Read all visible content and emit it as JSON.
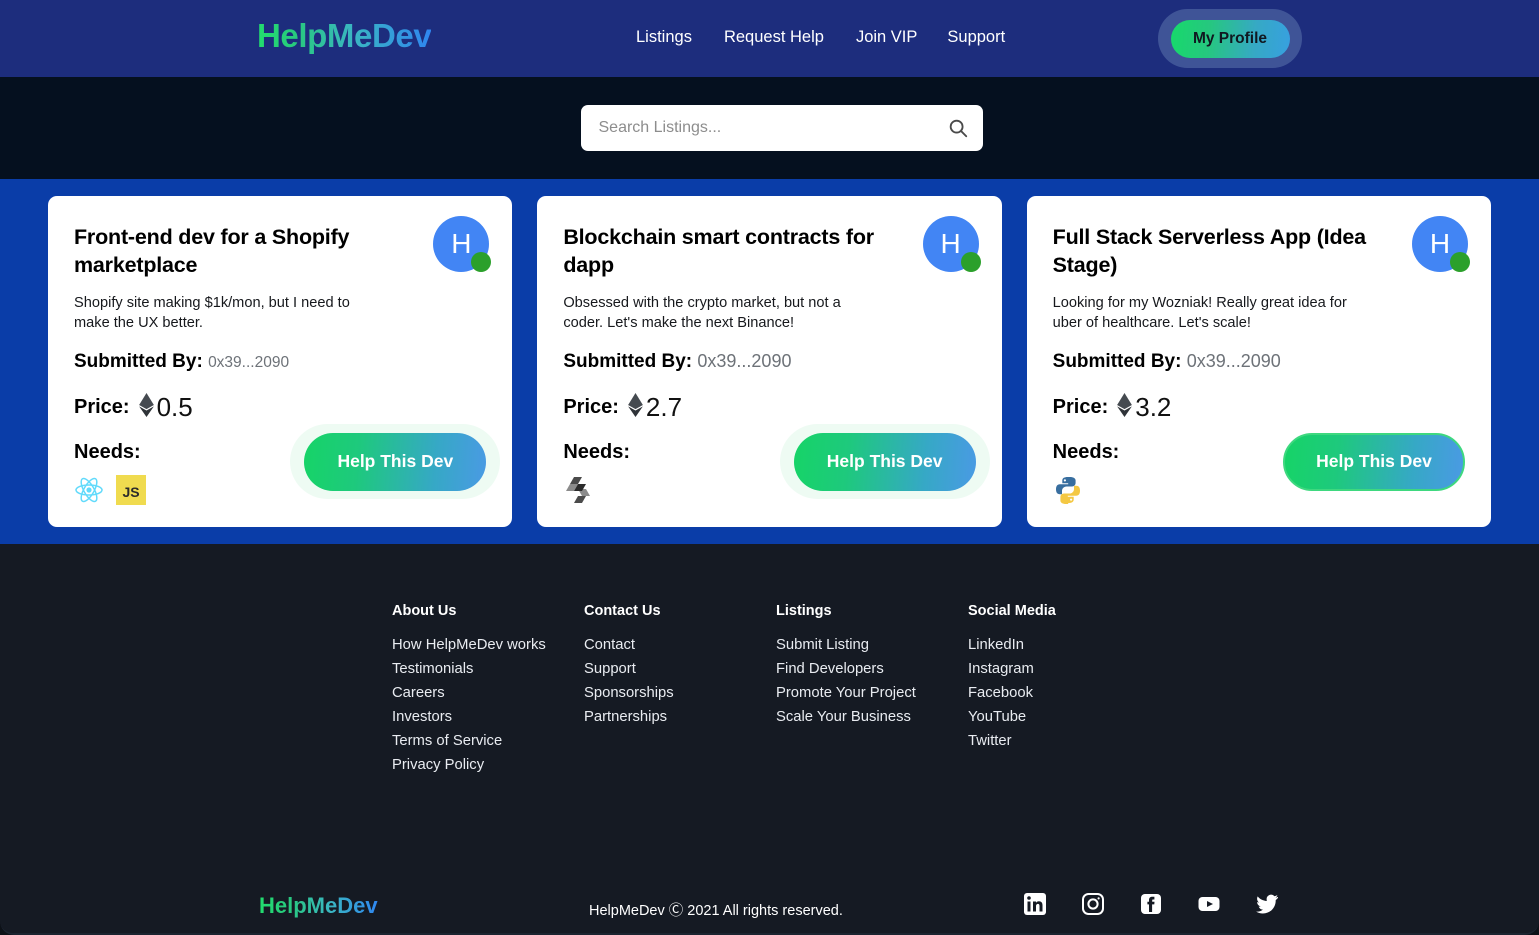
{
  "brand": {
    "name": "HelpMeDev"
  },
  "header": {
    "nav": [
      {
        "label": "Listings"
      },
      {
        "label": "Request Help"
      },
      {
        "label": "Join VIP"
      },
      {
        "label": "Support"
      }
    ],
    "profile_label": "My Profile"
  },
  "search": {
    "placeholder": "Search Listings...",
    "value": "",
    "icon": "search-icon"
  },
  "listings": [
    {
      "title": "Front-end dev for a Shopify marketplace",
      "description": "Shopify site making $1k/mon, but I need to make the UX better.",
      "submitted_label": "Submitted By:",
      "submitted_by": "0x39...2090",
      "price_label": "Price:",
      "price": "0.5",
      "currency_icon": "ethereum-icon",
      "needs_label": "Needs:",
      "needs": [
        "react-icon",
        "javascript-icon"
      ],
      "cta_label": "Help This Dev",
      "avatar_initial": "H",
      "status": "online"
    },
    {
      "title": "Blockchain smart contracts for dapp",
      "description": "Obsessed with the crypto market, but not a coder. Let's make the next Binance!",
      "submitted_label": "Submitted By:",
      "submitted_by": "0x39...2090",
      "price_label": "Price:",
      "price": "2.7",
      "currency_icon": "ethereum-icon",
      "needs_label": "Needs:",
      "needs": [
        "solidity-icon"
      ],
      "cta_label": "Help This Dev",
      "avatar_initial": "H",
      "status": "online"
    },
    {
      "title": "Full Stack Serverless App (Idea Stage)",
      "description": "Looking for my Wozniak! Really great idea for uber of healthcare. Let's scale!",
      "submitted_label": "Submitted By:",
      "submitted_by": "0x39...2090",
      "price_label": "Price:",
      "price": "3.2",
      "currency_icon": "ethereum-icon",
      "needs_label": "Needs:",
      "needs": [
        "python-icon"
      ],
      "cta_label": "Help This Dev",
      "avatar_initial": "H",
      "status": "online"
    }
  ],
  "footer": {
    "columns": [
      {
        "heading": "About Us",
        "links": [
          {
            "label": "How HelpMeDev works"
          },
          {
            "label": "Testimonials"
          },
          {
            "label": "Careers"
          },
          {
            "label": "Investors"
          },
          {
            "label": "Terms of Service"
          },
          {
            "label": "Privacy Policy"
          }
        ]
      },
      {
        "heading": "Contact Us",
        "links": [
          {
            "label": "Contact"
          },
          {
            "label": "Support"
          },
          {
            "label": "Sponsorships"
          },
          {
            "label": "Partnerships"
          }
        ]
      },
      {
        "heading": "Listings",
        "links": [
          {
            "label": "Submit Listing"
          },
          {
            "label": "Find Developers"
          },
          {
            "label": "Promote Your Project"
          },
          {
            "label": "Scale Your Business"
          }
        ]
      },
      {
        "heading": "Social Media",
        "links": [
          {
            "label": "LinkedIn"
          },
          {
            "label": "Instagram"
          },
          {
            "label": "Facebook"
          },
          {
            "label": "YouTube"
          },
          {
            "label": "Twitter"
          }
        ]
      }
    ],
    "logo": "HelpMeDev",
    "copyright": "HelpMeDev Ⓒ 2021 All rights reserved.",
    "social_icons": [
      "linkedin-icon",
      "instagram-icon",
      "facebook-icon",
      "youtube-icon",
      "twitter-icon"
    ]
  },
  "colors": {
    "header_bg": "#1d2d7d",
    "search_bg": "#05101f",
    "listings_bg": "#0a3da8",
    "footer_bg": "#151a23",
    "accent_green": "#16d467",
    "accent_blue": "#4a9ae4",
    "avatar_blue": "#4285f4",
    "status_green": "#2ba02b"
  }
}
